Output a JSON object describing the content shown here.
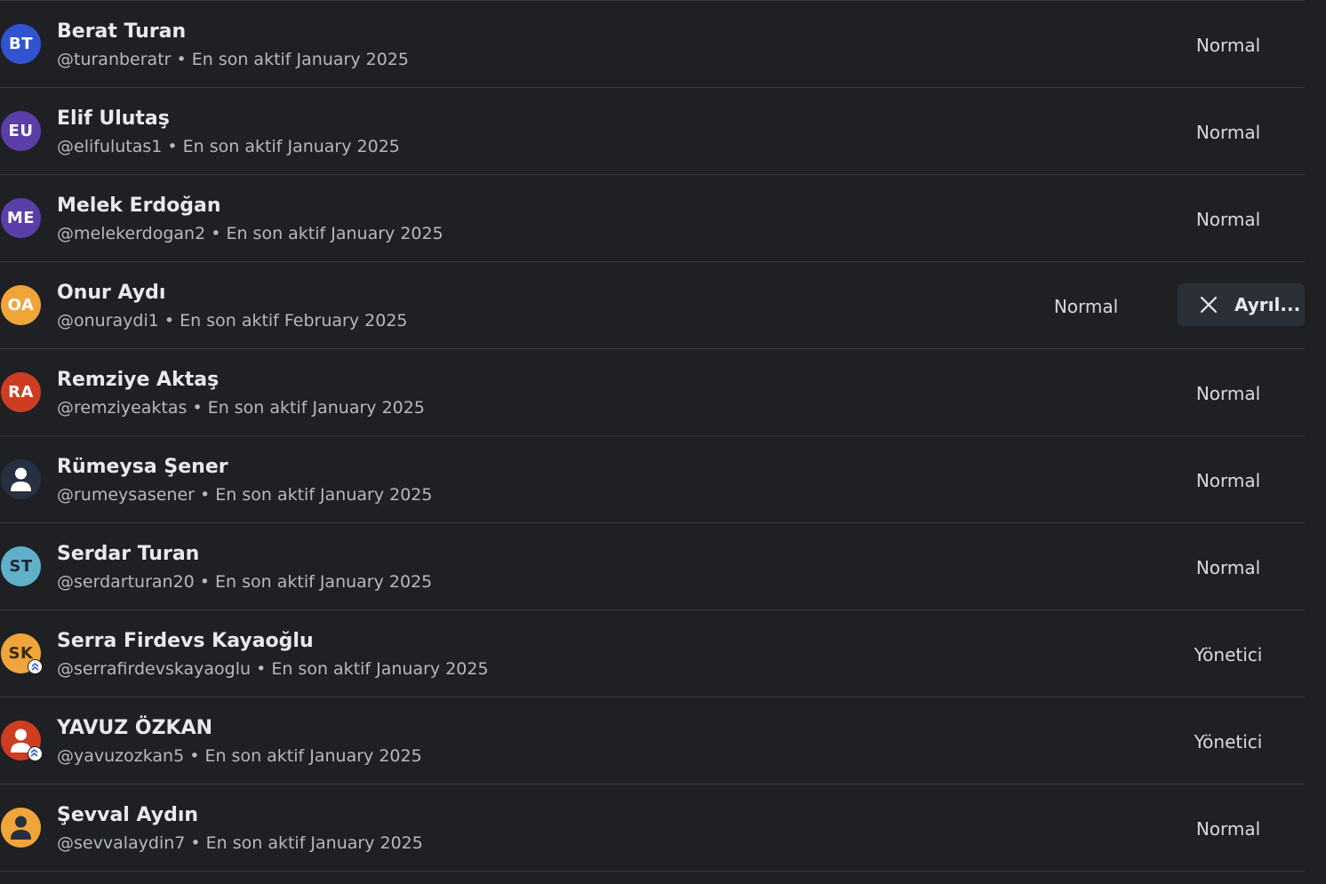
{
  "colors": {
    "background": "#1e2024",
    "divider": "#383b41",
    "leave_button": "#2b2f36"
  },
  "members": [
    {
      "initials": "BT",
      "avatar_color": "#3253d1",
      "avatar_type": "initials",
      "admin": false,
      "name": "Berat Turan",
      "meta": "@turanberatr • En son aktif January 2025",
      "role": "Normal"
    },
    {
      "initials": "EU",
      "avatar_color": "#5b3ea8",
      "avatar_type": "initials",
      "admin": false,
      "name": "Elif Ulutaş",
      "meta": "@elifulutas1 • En son aktif January 2025",
      "role": "Normal"
    },
    {
      "initials": "ME",
      "avatar_color": "#5b3ea8",
      "avatar_type": "initials",
      "admin": false,
      "name": "Melek Erdoğan",
      "meta": "@melekerdogan2 • En son aktif January 2025",
      "role": "Normal"
    },
    {
      "initials": "OA",
      "avatar_color": "#f0a53a",
      "avatar_type": "initials",
      "admin": false,
      "name": "Onur Aydı",
      "meta": "@onuraydi1 • En son aktif February 2025",
      "role": "Normal",
      "leave_label": "Ayrıl..."
    },
    {
      "initials": "RA",
      "avatar_color": "#cd3d22",
      "avatar_type": "initials",
      "admin": false,
      "name": "Remziye Aktaş",
      "meta": "@remziyeaktas • En son aktif January 2025",
      "role": "Normal"
    },
    {
      "initials": "",
      "avatar_color": "#263040",
      "avatar_type": "photo",
      "admin": false,
      "name": "Rümeysa Şener",
      "meta": "@rumeysasener • En son aktif January 2025",
      "role": "Normal"
    },
    {
      "initials": "ST",
      "avatar_color": "#5fb0c8",
      "avatar_type": "initials",
      "admin": false,
      "name": "Serdar Turan",
      "meta": "@serdarturan20 • En son aktif January 2025",
      "role": "Normal"
    },
    {
      "initials": "SK",
      "avatar_color": "#f0a53a",
      "avatar_type": "initials",
      "admin": true,
      "name": "Serra Firdevs Kayaoğlu",
      "meta": "@serrafirdevskayaoglu • En son aktif January 2025",
      "role": "Yönetici"
    },
    {
      "initials": "",
      "avatar_color": "#cd3d22",
      "avatar_type": "photo",
      "admin": true,
      "name": "YAVUZ ÖZKAN",
      "meta": "@yavuzozkan5 • En son aktif January 2025",
      "role": "Yönetici"
    },
    {
      "initials": "",
      "avatar_color": "#f0a53a",
      "avatar_type": "photo",
      "admin": false,
      "name": "Şevval Aydın",
      "meta": "@sevvalaydin7 • En son aktif January 2025",
      "role": "Normal"
    }
  ]
}
